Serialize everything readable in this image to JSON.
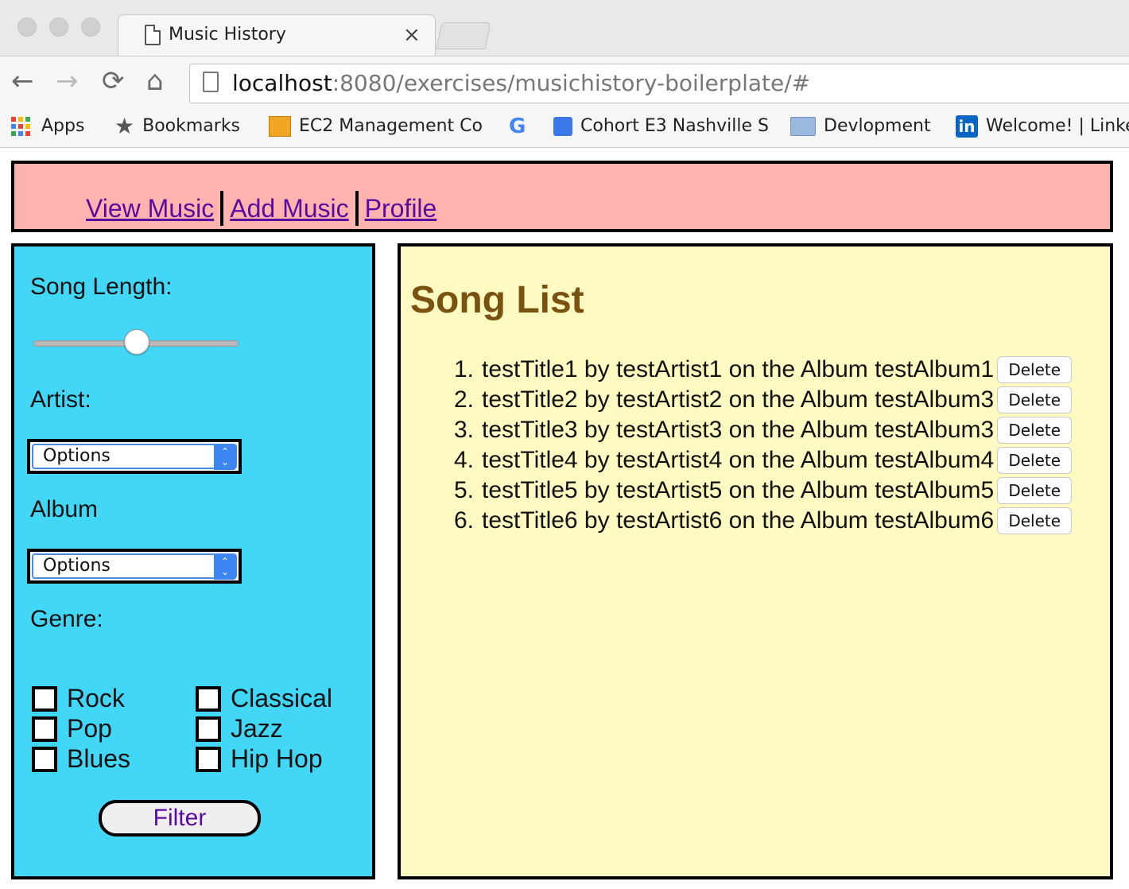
{
  "browser": {
    "tab_title": "Music History",
    "tab_close": "×",
    "url_host": "localhost",
    "url_rest": ":8080/exercises/musichistory-boilerplate/#",
    "nav": {
      "back": "←",
      "forward": "→",
      "reload": "⟳",
      "home": "⌂"
    },
    "bookmarks": [
      {
        "label": "Apps",
        "icon": "apps-grid-icon"
      },
      {
        "label": "Bookmarks",
        "icon": "star-icon"
      },
      {
        "label": "EC2 Management Co",
        "icon": "box-icon"
      },
      {
        "label": "",
        "icon": "google-icon"
      },
      {
        "label": "Cohort E3 Nashville S",
        "icon": "classroom-icon"
      },
      {
        "label": "Devlopment",
        "icon": "folder-icon"
      },
      {
        "label": "Welcome! | Linke",
        "icon": "linkedin-icon"
      }
    ]
  },
  "header": {
    "nav": [
      "View Music",
      "Add Music",
      "Profile"
    ]
  },
  "sidebar": {
    "song_length_label": "Song Length:",
    "slider_value_fraction": 0.5,
    "artist_label": "Artist:",
    "artist_select": "Options",
    "album_label": "Album",
    "album_select": "Options",
    "genre_label": "Genre:",
    "genres": [
      "Rock",
      "Classical",
      "Pop",
      "Jazz",
      "Blues",
      "Hip Hop"
    ],
    "filter_button": "Filter"
  },
  "main": {
    "title": "Song List",
    "delete_label": "Delete",
    "songs": [
      {
        "num": "1.",
        "text": "testTitle1 by testArtist1 on the Album testAlbum1"
      },
      {
        "num": "2.",
        "text": "testTitle2 by testArtist2 on the Album testAlbum3"
      },
      {
        "num": "3.",
        "text": "testTitle3 by testArtist3 on the Album testAlbum3"
      },
      {
        "num": "4.",
        "text": "testTitle4 by testArtist4 on the Album testAlbum4"
      },
      {
        "num": "5.",
        "text": "testTitle5 by testArtist5 on the Album testAlbum5"
      },
      {
        "num": "6.",
        "text": "testTitle6 by testArtist6 on the Album testAlbum6"
      }
    ]
  },
  "colors": {
    "header_bg": "#ffb3ae",
    "sidebar_bg": "#42d6f7",
    "main_bg": "#fffac1",
    "link": "#5b0aa0",
    "title": "#7a5210"
  }
}
